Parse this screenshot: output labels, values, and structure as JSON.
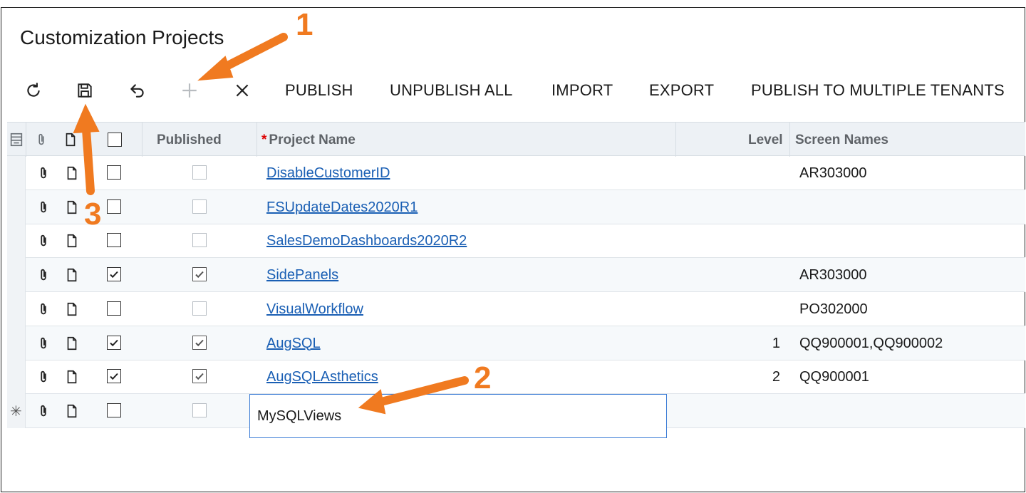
{
  "page": {
    "title": "Customization Projects"
  },
  "toolbar": {
    "icons": [
      "refresh-icon",
      "save-icon",
      "undo-icon",
      "add-icon",
      "delete-icon"
    ],
    "publish": "PUBLISH",
    "unpublish_all": "UNPUBLISH ALL",
    "import": "IMPORT",
    "export": "EXPORT",
    "publish_multiple": "PUBLISH TO MULTIPLE TENANTS"
  },
  "grid": {
    "headers": {
      "published": "Published",
      "required_mark": "*",
      "project_name": "Project Name",
      "level": "Level",
      "screen_names": "Screen Names"
    },
    "rows": [
      {
        "selected": false,
        "published": false,
        "name": "DisableCustomerID",
        "level": "",
        "screens": "AR303000"
      },
      {
        "selected": false,
        "published": false,
        "name": "FSUpdateDates2020R1",
        "level": "",
        "screens": ""
      },
      {
        "selected": false,
        "published": false,
        "name": "SalesDemoDashboards2020R2",
        "level": "",
        "screens": ""
      },
      {
        "selected": true,
        "published": true,
        "name": "SidePanels",
        "level": "",
        "screens": "AR303000"
      },
      {
        "selected": false,
        "published": false,
        "name": "VisualWorkflow",
        "level": "",
        "screens": "PO302000"
      },
      {
        "selected": true,
        "published": true,
        "name": "AugSQL",
        "level": "1",
        "screens": "QQ900001,QQ900002"
      },
      {
        "selected": true,
        "published": true,
        "name": "AugSQLAsthetics",
        "level": "2",
        "screens": "QQ900001"
      }
    ],
    "new_row": {
      "indicator": "✳",
      "name_value": "MySQLViews"
    }
  },
  "annotations": {
    "arrow_color": "#f07a20",
    "labels": [
      "1",
      "2",
      "3"
    ]
  }
}
